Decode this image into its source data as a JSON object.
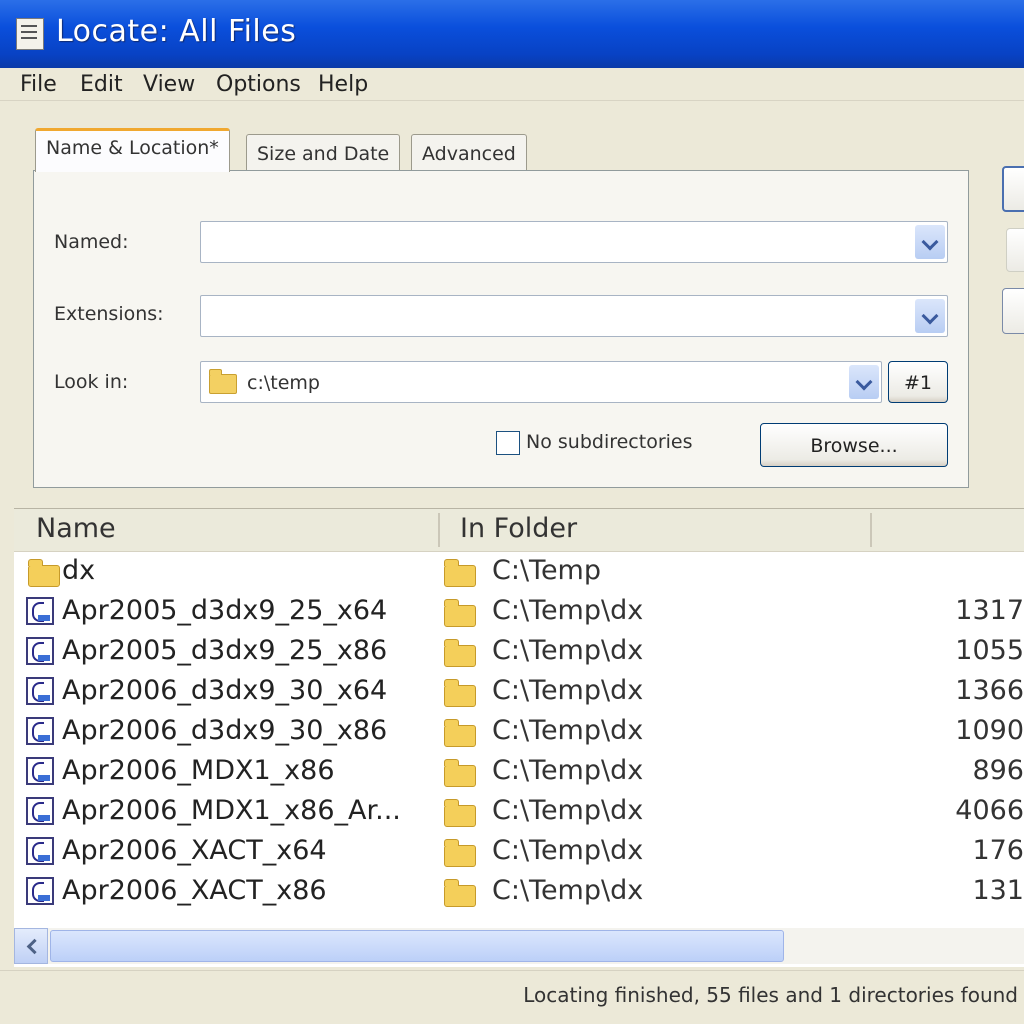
{
  "window": {
    "title": "Locate: All Files"
  },
  "menu": [
    "File",
    "Edit",
    "View",
    "Options",
    "Help"
  ],
  "tabs": [
    {
      "label": "Name & Location*",
      "active": true
    },
    {
      "label": "Size and Date",
      "active": false
    },
    {
      "label": "Advanced",
      "active": false
    }
  ],
  "form": {
    "named_label": "Named:",
    "named_value": "",
    "extensions_label": "Extensions:",
    "extensions_value": "",
    "lookin_label": "Look in:",
    "lookin_value": "c:\\temp",
    "lookin_number": "#1",
    "no_subdirs_label": "No subdirectories",
    "no_subdirs_checked": false,
    "browse_label": "Browse..."
  },
  "results": {
    "columns": [
      "Name",
      "In Folder"
    ],
    "rows": [
      {
        "icon": "folder-icon",
        "name": "dx",
        "folder": "C:\\Temp",
        "size": ""
      },
      {
        "icon": "exe-icon",
        "name": "Apr2005_d3dx9_25_x64",
        "folder": "C:\\Temp\\dx",
        "size": "1317"
      },
      {
        "icon": "exe-icon",
        "name": "Apr2005_d3dx9_25_x86",
        "folder": "C:\\Temp\\dx",
        "size": "1055"
      },
      {
        "icon": "exe-icon",
        "name": "Apr2006_d3dx9_30_x64",
        "folder": "C:\\Temp\\dx",
        "size": "1366"
      },
      {
        "icon": "exe-icon",
        "name": "Apr2006_d3dx9_30_x86",
        "folder": "C:\\Temp\\dx",
        "size": "1090"
      },
      {
        "icon": "exe-icon",
        "name": "Apr2006_MDX1_x86",
        "folder": "C:\\Temp\\dx",
        "size": "896"
      },
      {
        "icon": "exe-icon",
        "name": "Apr2006_MDX1_x86_Ar...",
        "folder": "C:\\Temp\\dx",
        "size": "4066"
      },
      {
        "icon": "exe-icon",
        "name": "Apr2006_XACT_x64",
        "folder": "C:\\Temp\\dx",
        "size": "176"
      },
      {
        "icon": "exe-icon",
        "name": "Apr2006_XACT_x86",
        "folder": "C:\\Temp\\dx",
        "size": "131"
      }
    ]
  },
  "status": {
    "text": "Locating finished, 55 files and 1 directories found"
  },
  "colors": {
    "titlebar": "#0a4fdc",
    "tab_accent": "#f0a830",
    "chrome": "#ece9d8"
  }
}
